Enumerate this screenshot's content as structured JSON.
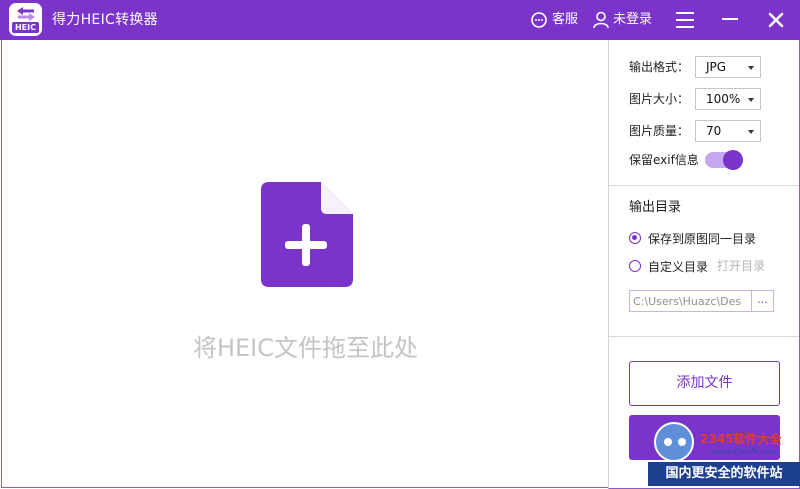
{
  "app": {
    "title": "得力HEIC转换器",
    "logo_tag": "HEIC",
    "accent_color": "#7b34c9"
  },
  "header": {
    "service_label": "客服",
    "login_label": "未登录",
    "service_icon": "chat-bubble-icon",
    "login_icon": "user-icon",
    "menu_icon": "hamburger-menu-icon",
    "minimize_icon": "minimize-icon",
    "close_icon": "close-icon"
  },
  "dropzone": {
    "icon": "add-file-icon",
    "text": "将HEIC文件拖至此处"
  },
  "settings": {
    "format": {
      "label": "输出格式：",
      "value": "JPG"
    },
    "size": {
      "label": "图片大小：",
      "value": "100%"
    },
    "quality": {
      "label": "图片质量：",
      "value": "70"
    },
    "exif": {
      "label": "保留exif信息",
      "enabled": true
    }
  },
  "output": {
    "title": "输出目录",
    "option_same": "保存到原图同一目录",
    "option_custom": "自定义目录",
    "open_dir": "打开目录",
    "selected": "same",
    "path": "C:\\Users\\Huazc\\Des",
    "browse_label": "..."
  },
  "actions": {
    "add_files": "添加文件"
  },
  "watermark": {
    "brand": "2345软件大全",
    "url": "www.DuoTe.com",
    "slogan": "国内更安全的软件站"
  }
}
